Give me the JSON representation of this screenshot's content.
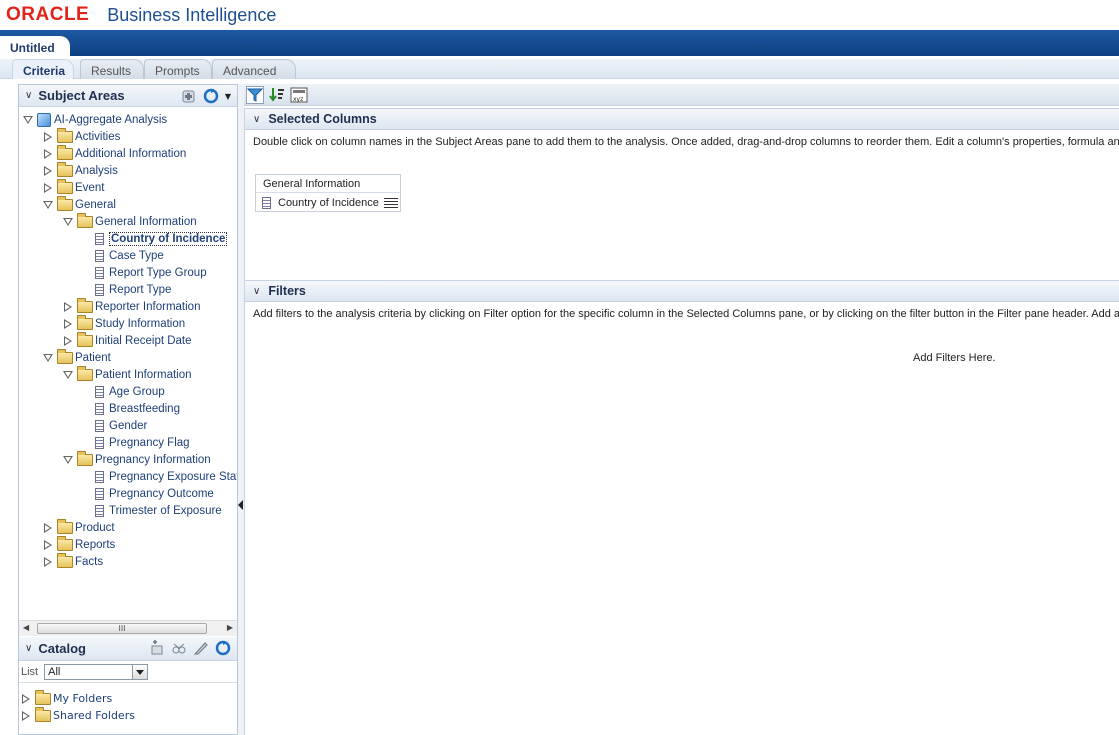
{
  "header": {
    "logo": "ORACLE",
    "app_title": "Business Intelligence"
  },
  "document_tab": "Untitled",
  "subtabs": [
    "Criteria",
    "Results",
    "Prompts",
    "Advanced"
  ],
  "subject_areas": {
    "title": "Subject Areas",
    "tree": [
      {
        "label": "AI-Aggregate Analysis",
        "type": "cube",
        "state": "open",
        "depth": 0
      },
      {
        "label": "Activities",
        "type": "folder",
        "state": "closed",
        "depth": 1
      },
      {
        "label": "Additional Information",
        "type": "folder",
        "state": "closed",
        "depth": 1
      },
      {
        "label": "Analysis",
        "type": "folder",
        "state": "closed",
        "depth": 1
      },
      {
        "label": "Event",
        "type": "folder",
        "state": "closed",
        "depth": 1
      },
      {
        "label": "General",
        "type": "folder",
        "state": "open",
        "depth": 1
      },
      {
        "label": "General Information",
        "type": "folder",
        "state": "open",
        "depth": 2
      },
      {
        "label": "Country of Incidence",
        "type": "column",
        "depth": 3,
        "selected": true
      },
      {
        "label": "Case Type",
        "type": "column",
        "depth": 3
      },
      {
        "label": "Report Type Group",
        "type": "column",
        "depth": 3
      },
      {
        "label": "Report Type",
        "type": "column",
        "depth": 3
      },
      {
        "label": "Reporter Information",
        "type": "folder",
        "state": "closed",
        "depth": 2
      },
      {
        "label": "Study Information",
        "type": "folder",
        "state": "closed",
        "depth": 2
      },
      {
        "label": "Initial Receipt Date",
        "type": "folder",
        "state": "closed",
        "depth": 2
      },
      {
        "label": "Patient",
        "type": "folder",
        "state": "open",
        "depth": 1
      },
      {
        "label": "Patient Information",
        "type": "folder",
        "state": "open",
        "depth": 2
      },
      {
        "label": "Age Group",
        "type": "column",
        "depth": 3
      },
      {
        "label": "Breastfeeding",
        "type": "column",
        "depth": 3
      },
      {
        "label": "Gender",
        "type": "column",
        "depth": 3
      },
      {
        "label": "Pregnancy Flag",
        "type": "column",
        "depth": 3
      },
      {
        "label": "Pregnancy Information",
        "type": "folder",
        "state": "open",
        "depth": 2
      },
      {
        "label": "Pregnancy Exposure Stat",
        "type": "column",
        "depth": 3
      },
      {
        "label": "Pregnancy Outcome",
        "type": "column",
        "depth": 3
      },
      {
        "label": "Trimester of Exposure",
        "type": "column",
        "depth": 3
      },
      {
        "label": "Product",
        "type": "folder",
        "state": "closed",
        "depth": 1
      },
      {
        "label": "Reports",
        "type": "folder",
        "state": "closed",
        "depth": 1
      },
      {
        "label": "Facts",
        "type": "folder",
        "state": "closed",
        "depth": 1
      }
    ],
    "scroll_thumb_label": "III"
  },
  "catalog": {
    "title": "Catalog",
    "list_label": "List",
    "list_value": "All",
    "items": [
      "My Folders",
      "Shared Folders"
    ]
  },
  "selected_columns": {
    "title": "Selected Columns",
    "description": "Double click on column names in the Subject Areas pane to add them to the analysis. Once added, drag-and-drop columns to reorder them. Edit a column's properties, formula and fi",
    "group": "General Information",
    "column": "Country of Incidence"
  },
  "filters": {
    "title": "Filters",
    "description": "Add filters to the analysis criteria by clicking on Filter option for the specific column in the Selected Columns pane, or by clicking on the filter button in the Filter pane header. Add a sa",
    "placeholder": "Add Filters Here."
  },
  "colors": {
    "brand_red": "#e2231a",
    "title_blue": "#1e4f93",
    "band_blue": "#0e3f82"
  }
}
